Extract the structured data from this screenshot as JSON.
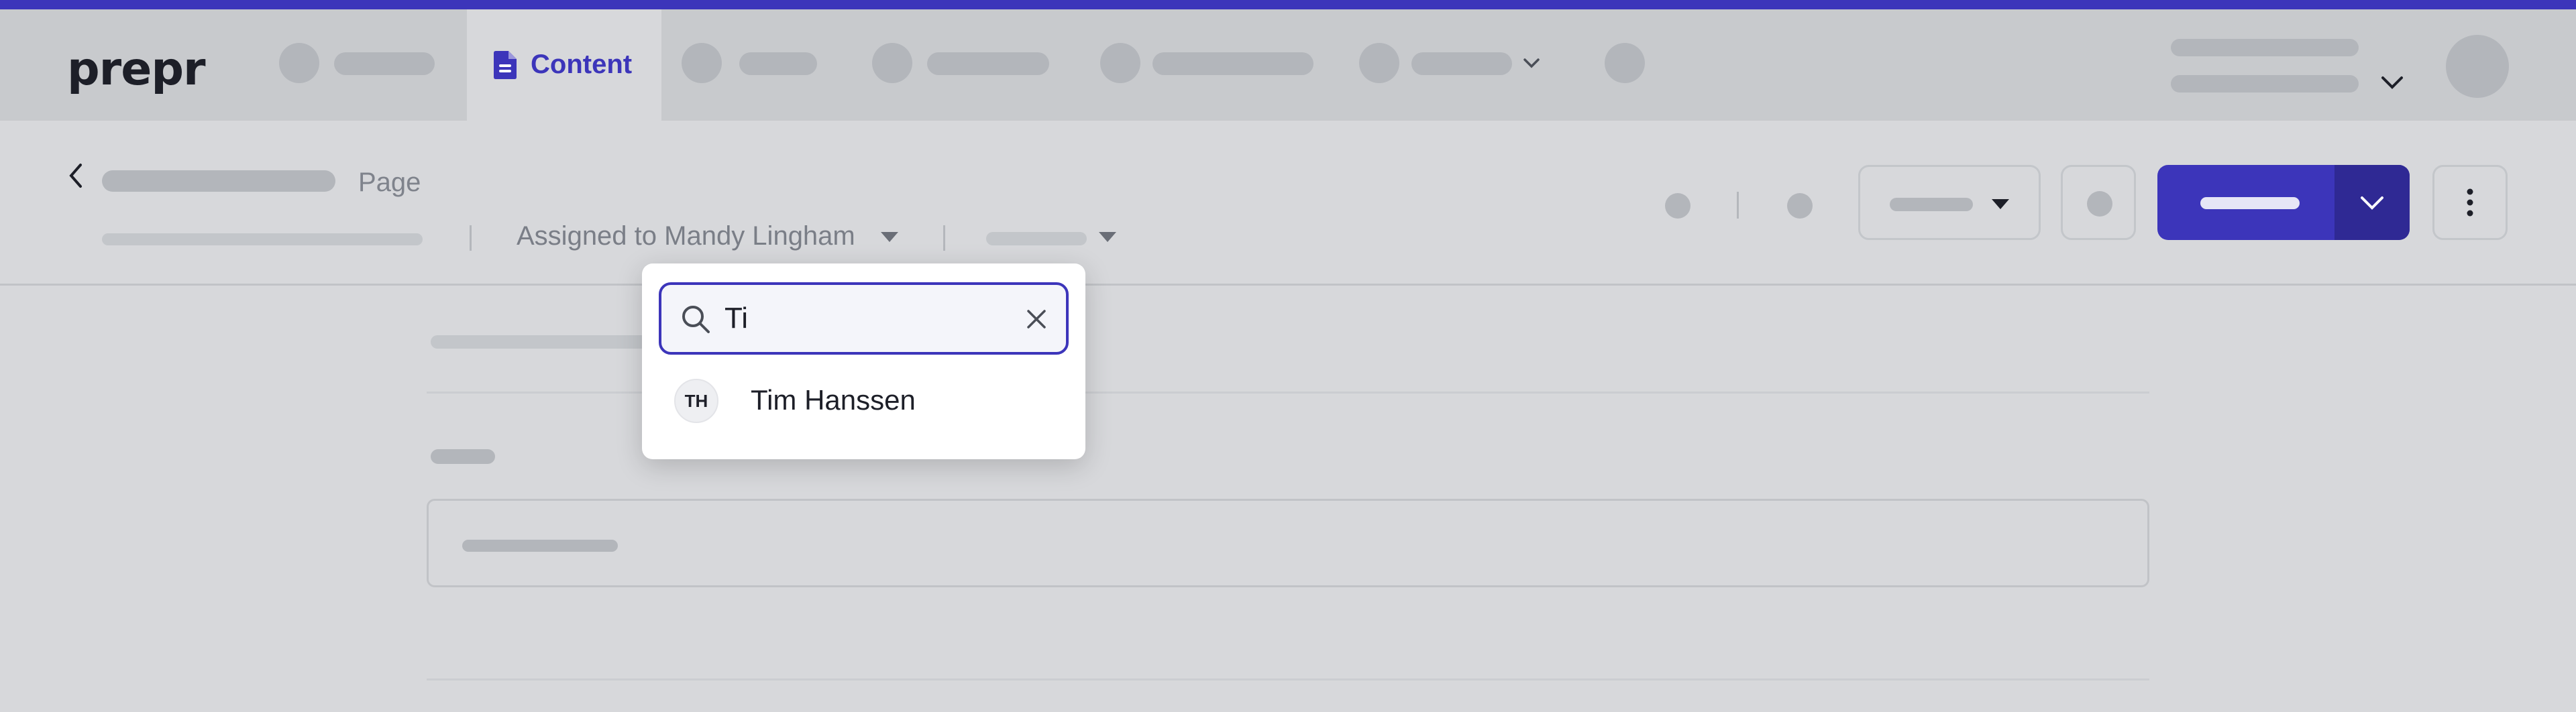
{
  "app": {
    "logo_text": "prepr"
  },
  "nav": {
    "active_tab_label": "Content"
  },
  "header": {
    "page_type": "Page",
    "assigned_label": "Assigned to Mandy Lingham"
  },
  "assignee_dropdown": {
    "search_value": "Ti",
    "results": [
      {
        "initials": "TH",
        "name": "Tim Hanssen"
      }
    ]
  },
  "colors": {
    "accent": "#3c35ba",
    "accent_dark": "#2f2994"
  },
  "icons": [
    "document-icon",
    "chevron-down-icon",
    "back-chevron-icon",
    "caret-down-icon",
    "more-vertical-icon",
    "search-icon",
    "close-icon"
  ]
}
